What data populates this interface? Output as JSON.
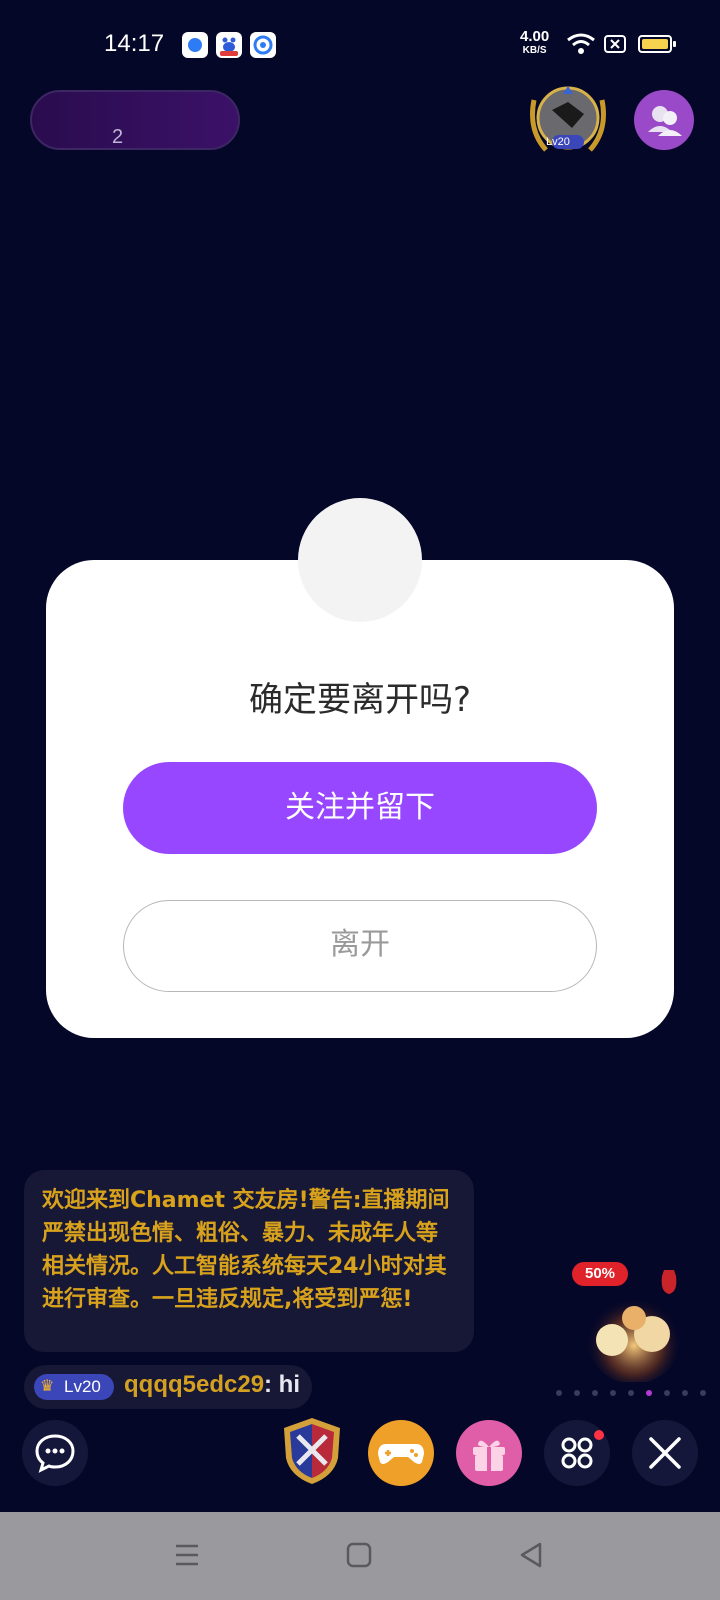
{
  "status_bar": {
    "time": "14:17",
    "net_speed_value": "4.00",
    "net_speed_unit": "KB/S",
    "icons": [
      "app-icon-1",
      "baidu-icon",
      "app-icon-3",
      "wifi-icon",
      "sim-x-icon",
      "battery-icon"
    ]
  },
  "room": {
    "pill_count": "2",
    "host_level_badge": "Lv20"
  },
  "dialog": {
    "title": "确定要离开吗?",
    "primary_label": "关注并留下",
    "secondary_label": "离开"
  },
  "chat": {
    "notice": "欢迎来到Chamet 交友房!警告:直播期间严禁出现色情、粗俗、暴力、未成年人等相关情况。人工智能系统每天24小时对其进行审查。一旦违反规定,将受到严惩!",
    "messages": [
      {
        "level": "Lv20",
        "username": "qqqq5edc29",
        "text": ": hi"
      }
    ]
  },
  "promo": {
    "badge": "50%"
  },
  "toolbar": {
    "icons": [
      "chat-bubble-icon",
      "battle-shield-icon",
      "gamepad-icon",
      "gift-icon",
      "grid-more-icon",
      "close-icon"
    ]
  },
  "colors": {
    "background": "#050728",
    "accent": "#9747ff",
    "gold_text": "#d9a21c"
  }
}
